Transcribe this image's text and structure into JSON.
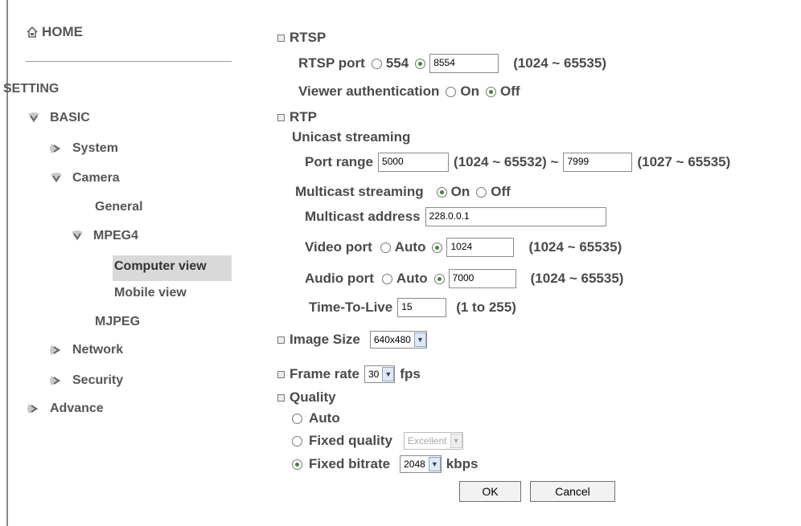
{
  "sidebar": {
    "home": "HOME",
    "setting": "SETTING",
    "basic": "BASIC",
    "system": "System",
    "camera": "Camera",
    "general": "General",
    "mpeg4": "MPEG4",
    "computer_view": "Computer view",
    "mobile_view": "Mobile view",
    "mjpeg": "MJPEG",
    "network": "Network",
    "security": "Security",
    "advance": "Advance"
  },
  "rtsp": {
    "section": "RTSP",
    "port_label": "RTSP port",
    "port_default": "554",
    "port_value": "8554",
    "port_range": "(1024 ~ 65535)",
    "auth_label": "Viewer authentication",
    "on": "On",
    "off": "Off"
  },
  "rtp": {
    "section": "RTP",
    "unicast": "Unicast streaming",
    "port_range_label": "Port range",
    "port_from": "5000",
    "range_from": "(1024 ~ 65532) ~",
    "port_to": "7999",
    "range_to": "(1027 ~ 65535)",
    "multicast": "Multicast streaming",
    "on": "On",
    "off": "Off",
    "mc_address_label": "Multicast address",
    "mc_address": "228.0.0.1",
    "video_port_label": "Video port",
    "auto": "Auto",
    "video_port": "1024",
    "video_range": "(1024 ~ 65535)",
    "audio_port_label": "Audio port",
    "audio_port": "7000",
    "audio_range": "(1024 ~ 65535)",
    "ttl_label": "Time-To-Live",
    "ttl": "15",
    "ttl_range": "(1 to 255)"
  },
  "image_size": {
    "label": "Image Size",
    "value": "640x480"
  },
  "frame_rate": {
    "label": "Frame rate",
    "value": "30",
    "unit": "fps"
  },
  "quality": {
    "section": "Quality",
    "auto": "Auto",
    "fixed_quality": "Fixed quality",
    "fixed_quality_value": "Excellent",
    "fixed_bitrate": "Fixed bitrate",
    "bitrate_value": "2048",
    "bitrate_unit": "kbps"
  },
  "buttons": {
    "ok": "OK",
    "cancel": "Cancel"
  },
  "colors": {
    "selected_bg": "#d9d9d9",
    "radio_dot": "#3b8a2e",
    "text": "#4a4a4a"
  }
}
